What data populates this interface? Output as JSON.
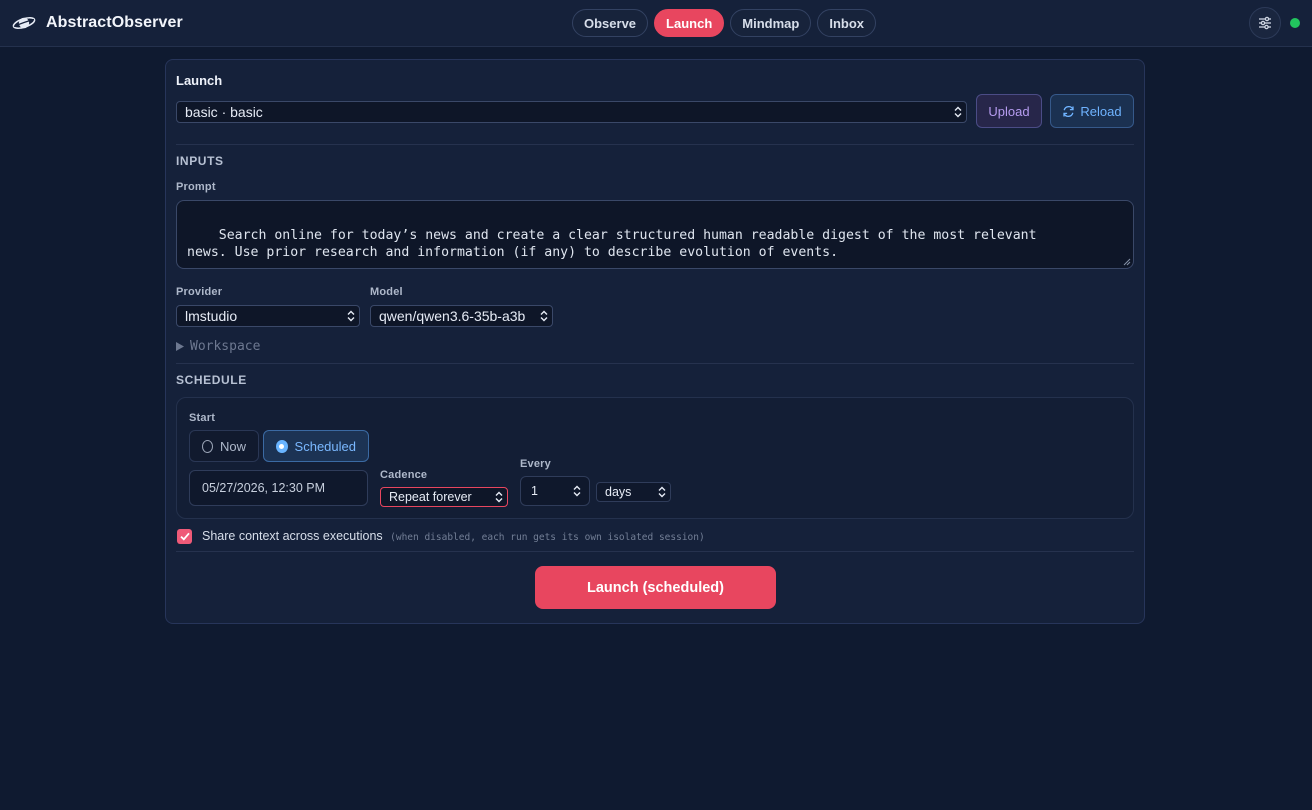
{
  "app": {
    "name": "AbstractObserver"
  },
  "nav": {
    "tabs": [
      {
        "label": "Observe",
        "active": false
      },
      {
        "label": "Launch",
        "active": true
      },
      {
        "label": "Mindmap",
        "active": false
      },
      {
        "label": "Inbox",
        "active": false
      }
    ]
  },
  "header": {
    "settings_icon": "sliders-icon",
    "status": "online",
    "status_color": "#22c55e"
  },
  "launch": {
    "title": "Launch",
    "flow_select": "basic · basic",
    "upload_label": "Upload",
    "reload_label": "Reload",
    "inputs": {
      "heading": "INPUTS",
      "prompt_label": "Prompt",
      "prompt_value": "Search online for today’s news and create a clear structured human readable digest of the most relevant\nnews. Use prior research and information (if any) to describe evolution of events.",
      "provider_label": "Provider",
      "provider_value": "lmstudio",
      "model_label": "Model",
      "model_value": "qwen/qwen3.6-35b-a3b",
      "workspace_label": "Workspace"
    },
    "schedule": {
      "heading": "SCHEDULE",
      "start_label": "Start",
      "now_label": "Now",
      "scheduled_label": "Scheduled",
      "selected": "Scheduled",
      "datetime_value": "05/27/2026, 12:30 PM",
      "cadence_label": "Cadence",
      "cadence_value": "Repeat forever",
      "every_label": "Every",
      "every_value": "1",
      "unit_value": "days"
    },
    "share_context": {
      "checked": true,
      "label": "Share context across executions",
      "note": "(when disabled, each run gets its own isolated session)"
    },
    "launch_button": "Launch (scheduled)"
  },
  "colors": {
    "accent": "#e8465f",
    "background": "#0f1a30",
    "panel": "#15213a",
    "link": "#6fb3ff"
  }
}
